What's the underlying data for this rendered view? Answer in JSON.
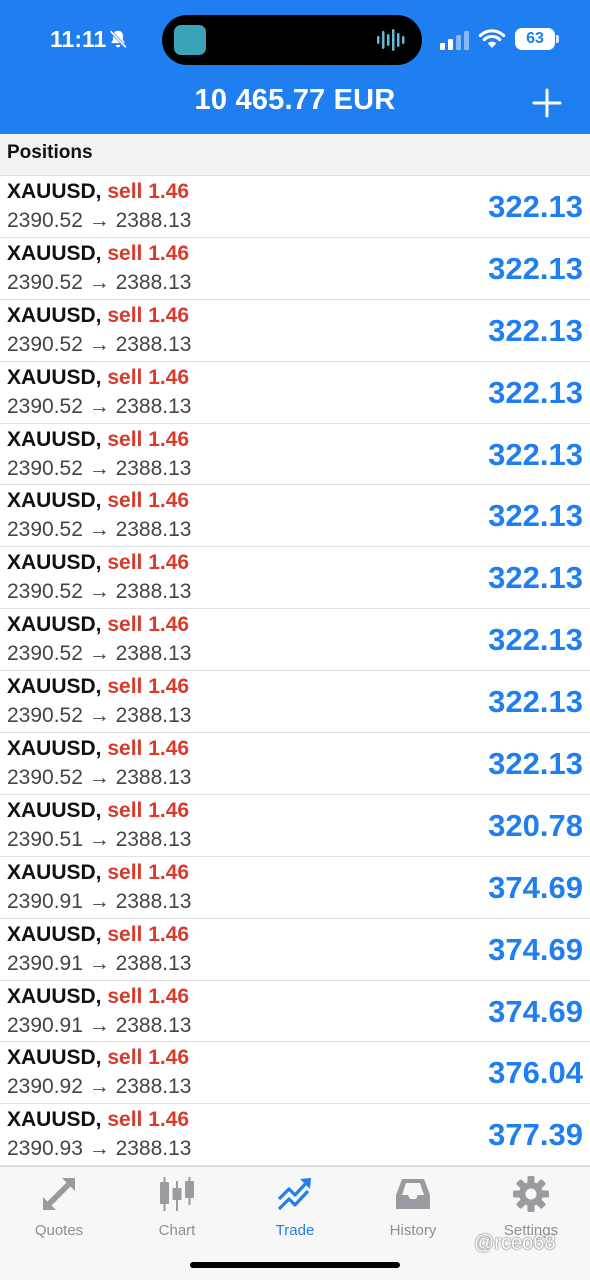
{
  "status_bar": {
    "time": "11:11",
    "battery": "63"
  },
  "header": {
    "balance": "10 465.77 EUR"
  },
  "section": {
    "title": "Positions"
  },
  "positions": [
    {
      "symbol": "XAUUSD,",
      "side": "sell 1.46",
      "prices": "2390.52 → 2388.13",
      "profit": "322.13"
    },
    {
      "symbol": "XAUUSD,",
      "side": "sell 1.46",
      "prices": "2390.52 → 2388.13",
      "profit": "322.13"
    },
    {
      "symbol": "XAUUSD,",
      "side": "sell 1.46",
      "prices": "2390.52 → 2388.13",
      "profit": "322.13"
    },
    {
      "symbol": "XAUUSD,",
      "side": "sell 1.46",
      "prices": "2390.52 → 2388.13",
      "profit": "322.13"
    },
    {
      "symbol": "XAUUSD,",
      "side": "sell 1.46",
      "prices": "2390.52 → 2388.13",
      "profit": "322.13"
    },
    {
      "symbol": "XAUUSD,",
      "side": "sell 1.46",
      "prices": "2390.52 → 2388.13",
      "profit": "322.13"
    },
    {
      "symbol": "XAUUSD,",
      "side": "sell 1.46",
      "prices": "2390.52 → 2388.13",
      "profit": "322.13"
    },
    {
      "symbol": "XAUUSD,",
      "side": "sell 1.46",
      "prices": "2390.52 → 2388.13",
      "profit": "322.13"
    },
    {
      "symbol": "XAUUSD,",
      "side": "sell 1.46",
      "prices": "2390.52 → 2388.13",
      "profit": "322.13"
    },
    {
      "symbol": "XAUUSD,",
      "side": "sell 1.46",
      "prices": "2390.52 → 2388.13",
      "profit": "322.13"
    },
    {
      "symbol": "XAUUSD,",
      "side": "sell 1.46",
      "prices": "2390.51 → 2388.13",
      "profit": "320.78"
    },
    {
      "symbol": "XAUUSD,",
      "side": "sell 1.46",
      "prices": "2390.91 → 2388.13",
      "profit": "374.69"
    },
    {
      "symbol": "XAUUSD,",
      "side": "sell 1.46",
      "prices": "2390.91 → 2388.13",
      "profit": "374.69"
    },
    {
      "symbol": "XAUUSD,",
      "side": "sell 1.46",
      "prices": "2390.91 → 2388.13",
      "profit": "374.69"
    },
    {
      "symbol": "XAUUSD,",
      "side": "sell 1.46",
      "prices": "2390.92 → 2388.13",
      "profit": "376.04"
    },
    {
      "symbol": "XAUUSD,",
      "side": "sell 1.46",
      "prices": "2390.93 → 2388.13",
      "profit": "377.39"
    }
  ],
  "tabs": [
    {
      "label": "Quotes",
      "icon": "quotes-icon"
    },
    {
      "label": "Chart",
      "icon": "candlestick-chart-icon"
    },
    {
      "label": "Trade",
      "icon": "trade-icon",
      "active": true
    },
    {
      "label": "History",
      "icon": "inbox-icon"
    },
    {
      "label": "Settings",
      "icon": "gear-icon"
    }
  ],
  "watermark": "@rceo68",
  "colors": {
    "brand": "#1f7ef0",
    "sell": "#d93a2b",
    "inactive_tab": "#8e8e93"
  }
}
